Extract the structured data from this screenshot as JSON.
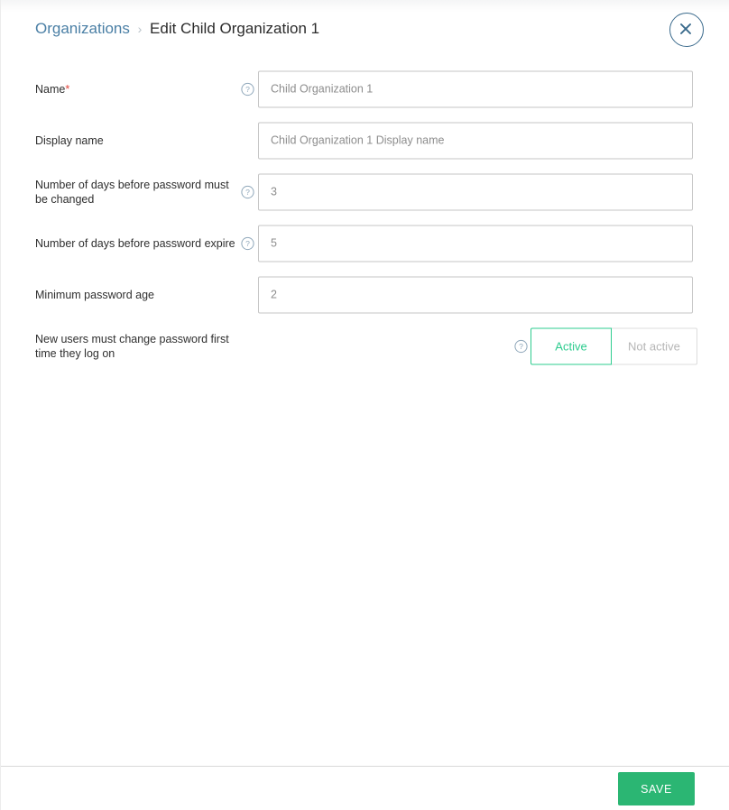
{
  "header": {
    "breadcrumb_parent": "Organizations",
    "breadcrumb_separator": "›",
    "breadcrumb_current": "Edit Child Organization 1",
    "close_icon": "close-x-icon"
  },
  "form": {
    "rows": [
      {
        "label": "Name",
        "required": true,
        "required_mark": "*",
        "help_icon": "question-mark-circle-icon",
        "has_help": true,
        "control": "text",
        "value": "Child Organization 1"
      },
      {
        "label": "Display name",
        "required": false,
        "required_mark": "",
        "help_icon": "",
        "has_help": false,
        "control": "text",
        "value": "Child Organization 1 Display name"
      },
      {
        "label": "Number of days before password must be changed",
        "required": false,
        "required_mark": "",
        "help_icon": "question-mark-circle-icon",
        "has_help": true,
        "control": "text",
        "value": "3"
      },
      {
        "label": "Number of days before password expire",
        "required": false,
        "required_mark": "",
        "help_icon": "question-mark-circle-icon",
        "has_help": true,
        "control": "text",
        "value": "5"
      },
      {
        "label": "Minimum password age",
        "required": false,
        "required_mark": "",
        "help_icon": "",
        "has_help": false,
        "control": "text",
        "value": "2"
      },
      {
        "label": "New users must change password first time they log on",
        "required": false,
        "required_mark": "",
        "help_icon": "question-mark-circle-icon",
        "has_help": true,
        "control": "toggle",
        "toggle_on_label": "Active",
        "toggle_off_label": "Not active",
        "toggle_selected": "Active"
      }
    ]
  },
  "footer": {
    "save_label": "SAVE"
  },
  "colors": {
    "accent_green": "#2bb673",
    "toggle_green": "#2ecc8f",
    "link_blue": "#4a7fa5",
    "close_blue": "#3a6a8c",
    "required_red": "#e2443b",
    "input_border": "#c6c6c6",
    "muted_text": "#8d8d8d"
  }
}
